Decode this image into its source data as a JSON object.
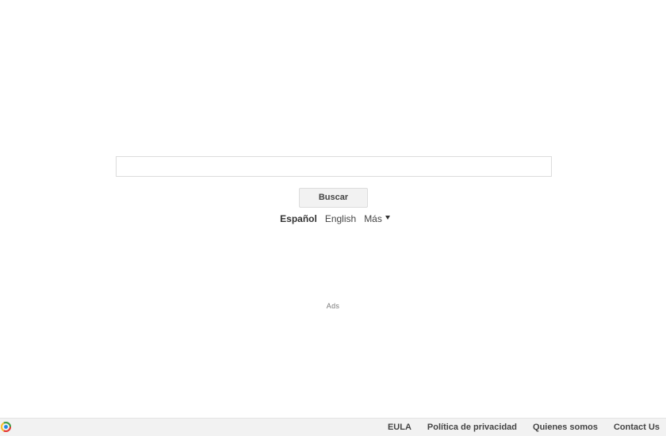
{
  "search": {
    "value": "",
    "placeholder": "",
    "button_label": "Buscar"
  },
  "languages": {
    "active": "Español",
    "secondary": "English",
    "more_label": "Más"
  },
  "ads": {
    "label": "Ads"
  },
  "footer": {
    "logo_icon": "brand-logo-icon",
    "links": [
      {
        "label": "EULA"
      },
      {
        "label": "Política de privacidad"
      },
      {
        "label": "Quienes somos"
      },
      {
        "label": "Contact Us"
      }
    ]
  },
  "colors": {
    "footer_bg": "#f2f2f2",
    "button_bg": "#f2f2f2",
    "border": "#dcdcdc",
    "text": "#444444"
  }
}
